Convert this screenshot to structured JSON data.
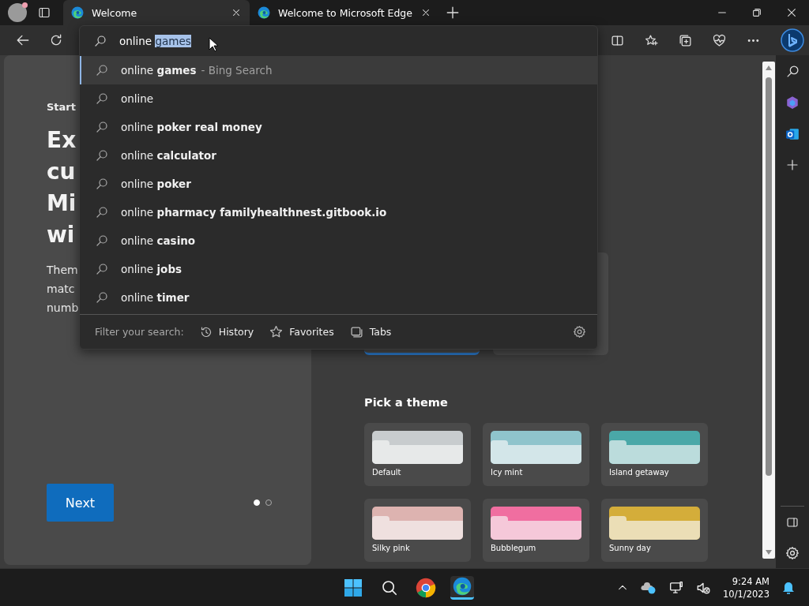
{
  "tabs": [
    {
      "title": "Welcome",
      "selected": true
    },
    {
      "title": "Welcome to Microsoft Edge",
      "selected": false
    }
  ],
  "address_bar": {
    "value": "online",
    "selected_text": "games"
  },
  "suggestions": [
    {
      "text": "online **games**",
      "hint": "- Bing Search",
      "selected": true
    },
    {
      "text": "online",
      "selected": false
    },
    {
      "text": "online **poker real money**",
      "selected": false
    },
    {
      "text": "online **calculator**",
      "selected": false
    },
    {
      "text": "online **poker**",
      "selected": false
    },
    {
      "text": "online **pharmacy familyhealthnest.gitbook.io**",
      "selected": false
    },
    {
      "text": "online **casino**",
      "selected": false
    },
    {
      "text": "online **jobs**",
      "selected": false
    },
    {
      "text": "online **timer**",
      "selected": false
    }
  ],
  "filter": {
    "label": "Filter your search:",
    "options": [
      {
        "kind": "history",
        "label": "History"
      },
      {
        "kind": "favorites",
        "label": "Favorites"
      },
      {
        "kind": "tabs",
        "label": "Tabs"
      }
    ]
  },
  "welcome": {
    "kicker": "Start",
    "heading_lines": [
      "Ex",
      "cu",
      "Mi",
      "wi"
    ],
    "body_lines": [
      "Them",
      "matc",
      "numb"
    ],
    "next_button": "Next",
    "steps": [
      {
        "selected": true
      },
      {
        "selected": false
      }
    ]
  },
  "layout_options": [
    {
      "selected": true
    },
    {
      "selected": false
    }
  ],
  "themes": {
    "title": "Pick a theme",
    "items": [
      {
        "name": "Default",
        "color": "#c8ccce"
      },
      {
        "name": "Icy mint",
        "color": "#8fc4cc"
      },
      {
        "name": "Island getaway",
        "color": "#4aa8a8"
      },
      {
        "name": "Silky pink",
        "color": "#ddb3b0"
      },
      {
        "name": "Bubblegum",
        "color": "#f06ea0"
      },
      {
        "name": "Sunny day",
        "color": "#d4ad3a"
      }
    ]
  },
  "clock": {
    "time": "9:24 AM",
    "date": "10/1/2023"
  }
}
